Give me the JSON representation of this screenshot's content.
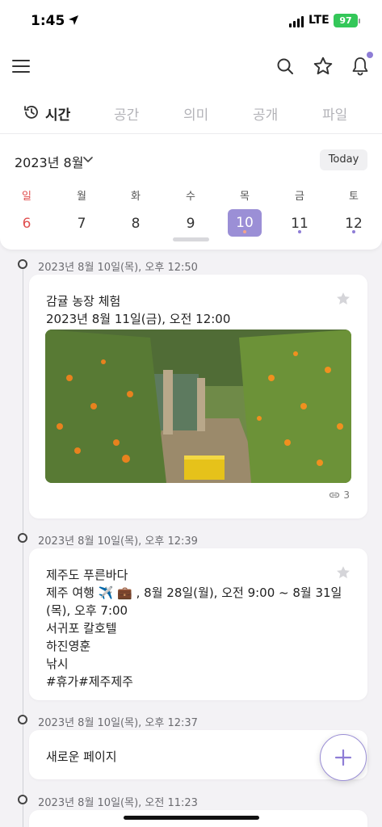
{
  "status": {
    "time": "1:45",
    "network": "LTE",
    "battery": "97"
  },
  "tabs": [
    {
      "label": "시간",
      "active": true
    },
    {
      "label": "공간"
    },
    {
      "label": "의미"
    },
    {
      "label": "공개"
    },
    {
      "label": "파일"
    }
  ],
  "calendar": {
    "month_label": "2023년 8월",
    "today_label": "Today",
    "weekdays": [
      "일",
      "월",
      "화",
      "수",
      "목",
      "금",
      "토"
    ],
    "days": [
      "6",
      "7",
      "8",
      "9",
      "10",
      "11",
      "12"
    ],
    "selected_day": "10"
  },
  "timeline": [
    {
      "timestamp": "2023년 8월 10일(목), 오후 12:50",
      "title": "감귤 농장 체험",
      "subtitle": "2023년 8월 11일(금), 오전 12:00",
      "link_count": "3"
    },
    {
      "timestamp": "2023년 8월 10일(목), 오후 12:39",
      "title": "제주도 푸른바다",
      "lines": [
        "제주 여행 ✈️ 💼 , 8월 28일(월), 오전 9:00 ~ 8월 31일",
        "(목), 오후 7:00",
        "서귀포 칼호텔",
        "하진영훈",
        "낚시",
        "#휴가#제주제주"
      ]
    },
    {
      "timestamp": "2023년 8월 10일(목), 오후 12:37",
      "title": "새로운 페이지"
    },
    {
      "timestamp": "2023년 8월 10일(목), 오전 11:23"
    }
  ],
  "colors": {
    "accent": "#9b8fd6",
    "sunday": "#e05050",
    "dot": "#8e7dd6"
  }
}
